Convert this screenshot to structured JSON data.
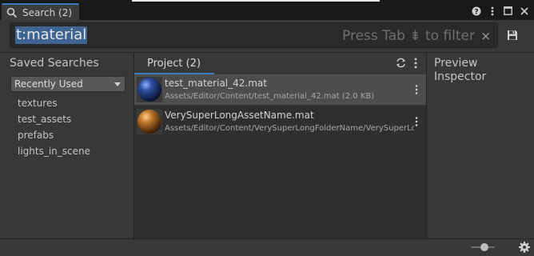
{
  "tab": {
    "title": "Search (2)",
    "icon": "search-icon"
  },
  "window_controls": [
    "help-icon",
    "menu-icon",
    "maximize-icon",
    "close-icon"
  ],
  "search": {
    "query": "t:material",
    "hint": "Press Tab ⇟ to filter",
    "clear_glyph": "×"
  },
  "left_panel": {
    "title": "Saved Searches",
    "dropdown": {
      "selected": "Recently Used"
    },
    "items": [
      "textures",
      "test_assets",
      "prefabs",
      "lights_in_scene"
    ]
  },
  "center_panel": {
    "tab_label": "Project (2)",
    "results": [
      {
        "name": "test_material_42.mat",
        "path": "Assets/Editor/Content/test_material_42.mat (2.0 KB)",
        "thumb_color": "#2f4f9e",
        "selected": true
      },
      {
        "name": "VerySuperLongAssetName.mat",
        "path": "Assets/Editor/Content/VerySuperLongFolderName/VerySuperLo",
        "thumb_color": "#c0792a",
        "selected": false
      }
    ]
  },
  "right_panel": {
    "line1": "Preview",
    "line2": "Inspector"
  },
  "colors": {
    "accent": "#3a79bb",
    "selection": "#3e6493",
    "panel": "#383838",
    "list_bg": "#2f2f2f"
  }
}
